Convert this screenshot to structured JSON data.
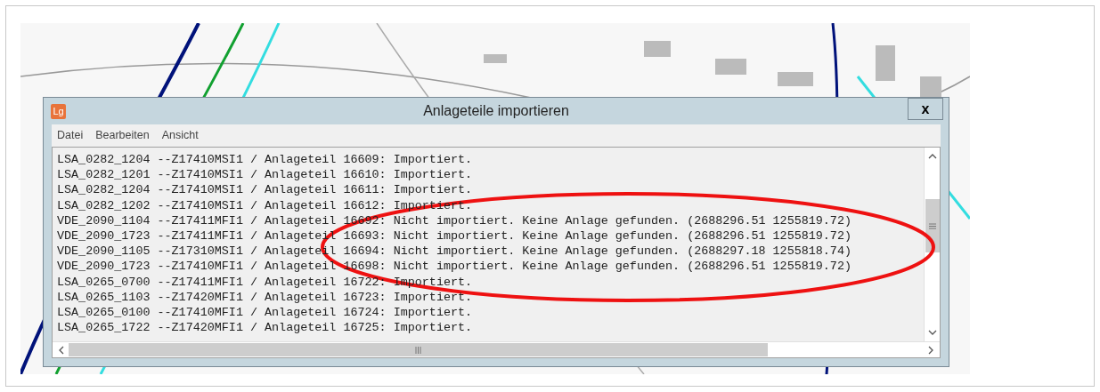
{
  "window": {
    "app_icon": "Lg",
    "title": "Anlageteile importieren",
    "close": "x"
  },
  "menu": [
    "Datei",
    "Bearbeiten",
    "Ansicht"
  ],
  "log_lines": [
    "LSA_0282_1204 --Z17410MSI1 / Anlageteil 16609: Importiert.",
    "LSA_0282_1201 --Z17410MSI1 / Anlageteil 16610: Importiert.",
    "LSA_0282_1204 --Z17410MSI1 / Anlageteil 16611: Importiert.",
    "LSA_0282_1202 --Z17410MSI1 / Anlageteil 16612: Importiert.",
    "VDE_2090_1104 --Z17411MFI1 / Anlageteil 16692: Nicht importiert. Keine Anlage gefunden. (2688296.51 1255819.72)",
    "VDE_2090_1723 --Z17411MFI1 / Anlageteil 16693: Nicht importiert. Keine Anlage gefunden. (2688296.51 1255819.72)",
    "VDE_2090_1105 --Z17310MSI1 / Anlageteil 16694: Nicht importiert. Keine Anlage gefunden. (2688297.18 1255818.74)",
    "VDE_2090_1723 --Z17410MFI1 / Anlageteil 16698: Nicht importiert. Keine Anlage gefunden. (2688296.51 1255819.72)",
    "LSA_0265_0700 --Z17411MFI1 / Anlageteil 16722: Importiert.",
    "LSA_0265_1103 --Z17420MFI1 / Anlageteil 16723: Importiert.",
    "LSA_0265_0100 --Z17410MFI1 / Anlageteil 16724: Importiert.",
    "LSA_0265_1722 --Z17420MFI1 / Anlageteil 16725: Importiert."
  ]
}
